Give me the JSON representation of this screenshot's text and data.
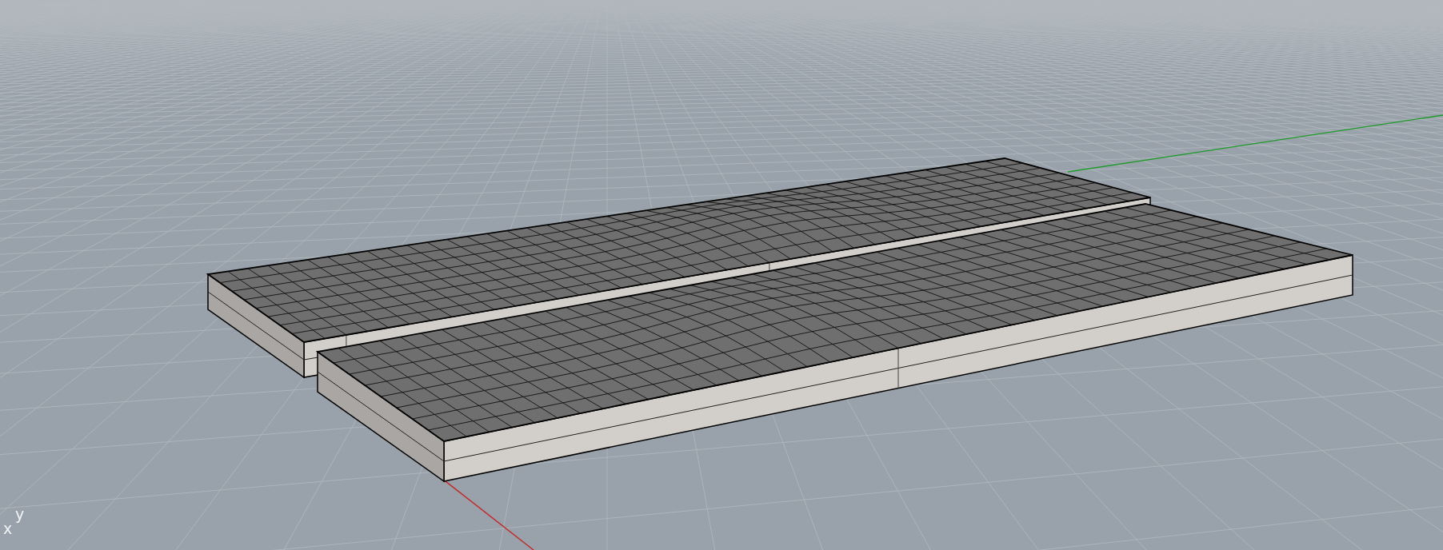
{
  "viewport": {
    "axis_labels": [
      {
        "kind": "x",
        "text": "x"
      },
      {
        "kind": "y",
        "text": "y"
      }
    ]
  }
}
